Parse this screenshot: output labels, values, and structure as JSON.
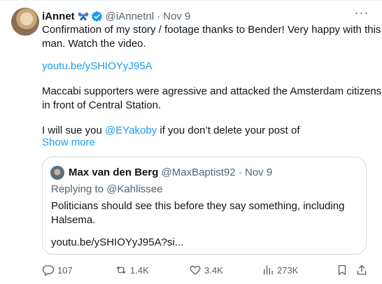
{
  "tweet": {
    "author_name": "iAnnet",
    "handle": "@iAnnetnl",
    "separator": "·",
    "date": "Nov 9",
    "more_label": "···",
    "text_line1": "Confirmation of my story / footage thanks to Bender! Very happy with this",
    "text_line2": "man. Watch the video.",
    "link": "youtu.be/ySHIOYyJ95A",
    "text_line3": "Maccabi supporters were agressive and attacked the Amsterdam citizens",
    "text_line4": "in front of Central Station.",
    "text_line5_prefix": "I will sue you ",
    "mention": "@EYakoby",
    "text_line5_suffix": " if you don’t delete your post of",
    "show_more": "Show more"
  },
  "quoted": {
    "author_name": "Max van den Berg",
    "handle": "@MaxBaptist92",
    "separator": "·",
    "date": "Nov 9",
    "replying_to": "Replying to @Kahlissee",
    "text_line1": "Politicians should see this before they say something, including",
    "text_line2": "Halsema.",
    "link": "youtu.be/ySHIOYyJ95A?si..."
  },
  "actions": {
    "replies": "107",
    "reposts": "1.4K",
    "likes": "3.4K",
    "views": "273K"
  },
  "icons": {
    "verified": "verified-badge-icon",
    "butterfly": "butterfly-emoji-icon",
    "reply": "reply-icon",
    "repost": "repost-icon",
    "like": "heart-icon",
    "views": "views-icon",
    "bookmark": "bookmark-icon",
    "share": "share-icon"
  },
  "colors": {
    "link": "#1d9bf0",
    "verified": "#1d9bf0",
    "muted": "#536471",
    "butterfly": "#3b82d6"
  }
}
